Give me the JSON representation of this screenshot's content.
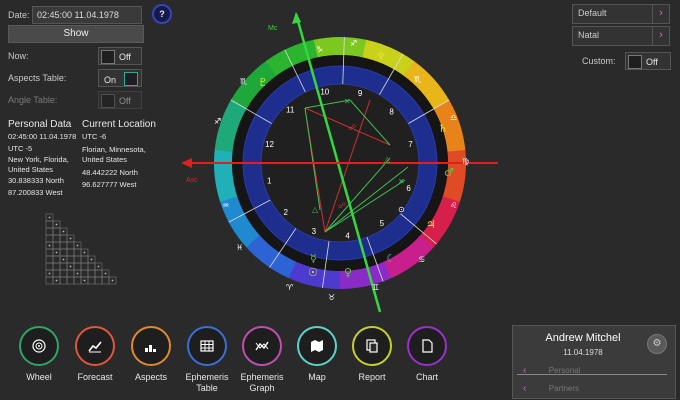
{
  "top_left": {
    "date_label": "Date:",
    "date_value": "02:45:00 11.04.1978",
    "show_button": "Show",
    "now_label": "Now:",
    "now_state": "Off",
    "aspects_table_label": "Aspects Table:",
    "aspects_table_state": "On",
    "angle_table_label": "Angle Table:",
    "angle_table_state": "Off",
    "help_label": "?"
  },
  "personal_data": {
    "title": "Personal Data",
    "lines": [
      "02:45:00 11.04.1978",
      "UTC -5",
      "New York, Florida,",
      "United States",
      "30.838333 North",
      "87.200833 West"
    ]
  },
  "current_location": {
    "title": "Current Location",
    "lines": [
      "UTC -6",
      "Florian, Minnesota,",
      "United States",
      "48.442222 North",
      "96.627777 West"
    ]
  },
  "top_right": {
    "default_label": "Default",
    "natal_label": "Natal",
    "custom_label": "Custom:",
    "custom_state": "Off"
  },
  "chart": {
    "mc_label": "Mc",
    "asc_label": "Asc",
    "house_numbers": [
      "1",
      "2",
      "3",
      "4",
      "5",
      "6",
      "7",
      "8",
      "9",
      "10",
      "11",
      "12"
    ]
  },
  "dock": [
    {
      "label": "Wheel",
      "color": "#2fa36b",
      "icon": "wheel-icon"
    },
    {
      "label": "Forecast",
      "color": "#e0573c",
      "icon": "forecast-icon"
    },
    {
      "label": "Aspects",
      "color": "#e08a2b",
      "icon": "aspects-icon"
    },
    {
      "label": "Ephemeris Table",
      "color": "#3b6fd8",
      "icon": "table-icon"
    },
    {
      "label": "Ephemeris Graph",
      "color": "#c04fb0",
      "icon": "graph-icon"
    },
    {
      "label": "Map",
      "color": "#5bd3c7",
      "icon": "map-icon"
    },
    {
      "label": "Report",
      "color": "#c7cf2e",
      "icon": "report-icon"
    },
    {
      "label": "Chart",
      "color": "#9b2fd0",
      "icon": "chart-icon"
    }
  ],
  "profile": {
    "name": "Andrew Mitchel",
    "date": "11.04.1978",
    "personal": "Personal",
    "partners": "Partners"
  }
}
